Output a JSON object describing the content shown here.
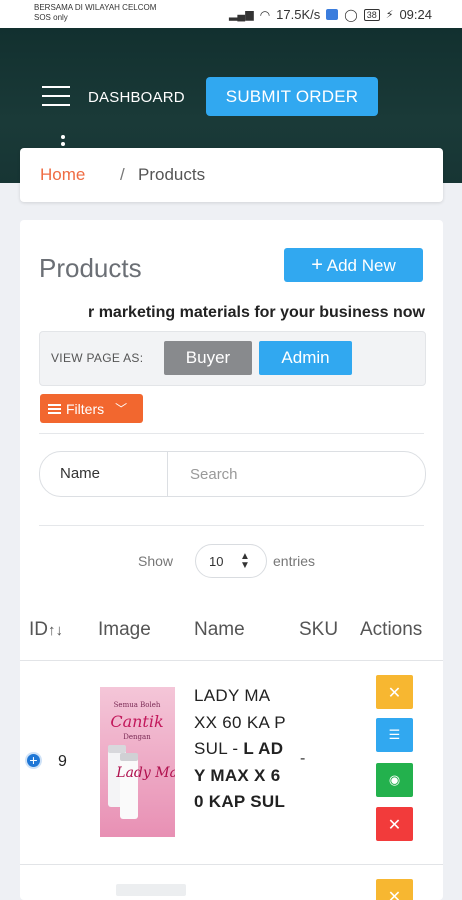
{
  "statusbar": {
    "carrier_line1": "BERSAMA DI WILAYAH CELCOM",
    "carrier_line2": "SOS only",
    "net_speed": "17.5K/s",
    "battery": "38",
    "time": "09:24"
  },
  "header": {
    "dashboard_label": "DASHBOARD",
    "submit_label": "SUBMIT ORDER"
  },
  "breadcrumb": {
    "home": "Home",
    "separator": "/",
    "current": "Products"
  },
  "products": {
    "title": "Products",
    "add_new_label": "Add New",
    "marquee_text": "r marketing materials for your business now",
    "view_as_label": "VIEW PAGE AS:",
    "buyer_label": "Buyer",
    "admin_label": "Admin",
    "filters_label": "Filters",
    "search_field_label": "Name",
    "search_placeholder": "Search",
    "show_label": "Show",
    "entries_value": "10",
    "entries_label": "entries"
  },
  "table": {
    "columns": [
      "ID",
      "Image",
      "Name",
      "SKU",
      "Actions"
    ],
    "rows": [
      {
        "id": "9",
        "name_plain": "LADY MA XX 60 KA PSUL - ",
        "name_bold": "L ADY MAX X 60 KAP SUL",
        "sku": "-",
        "image_text_1": "Semua Boleh",
        "image_text_2": "Cantik",
        "image_text_3": "Dengan",
        "image_text_4": "Lady Maxx"
      }
    ]
  },
  "colors": {
    "accent": "#31a8f0",
    "orange": "#f2672f",
    "breadcrumb_home": "#ef6c43",
    "edit": "#f7b731",
    "list": "#31a8f0",
    "view": "#23b14d",
    "delete": "#f23b3b",
    "header_bg": "#173534"
  }
}
